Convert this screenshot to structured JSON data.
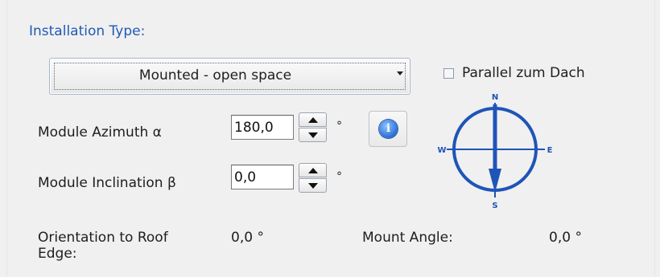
{
  "section": {
    "title": "Installation Type:"
  },
  "installation_type": {
    "selected": "Mounted - open space"
  },
  "parallel_roof": {
    "label": "Parallel zum Dach",
    "checked": false
  },
  "azimuth": {
    "label": "Module Azimuth α",
    "value": "180,0",
    "unit": "°"
  },
  "inclination": {
    "label": "Module Inclination β",
    "value": "0,0",
    "unit": "°"
  },
  "info_icon": "info-icon",
  "compass": {
    "north": "N",
    "south": "S",
    "east": "E",
    "west": "W",
    "color": "#1f54b8"
  },
  "orientation": {
    "label_line1": "Orientation to Roof",
    "label_line2": "Edge:",
    "value": "0,0 °"
  },
  "mount_angle": {
    "label": "Mount Angle:",
    "value": "0,0 °"
  },
  "colors": {
    "title": "#1f5ab6",
    "background": "#f0f0f0"
  }
}
